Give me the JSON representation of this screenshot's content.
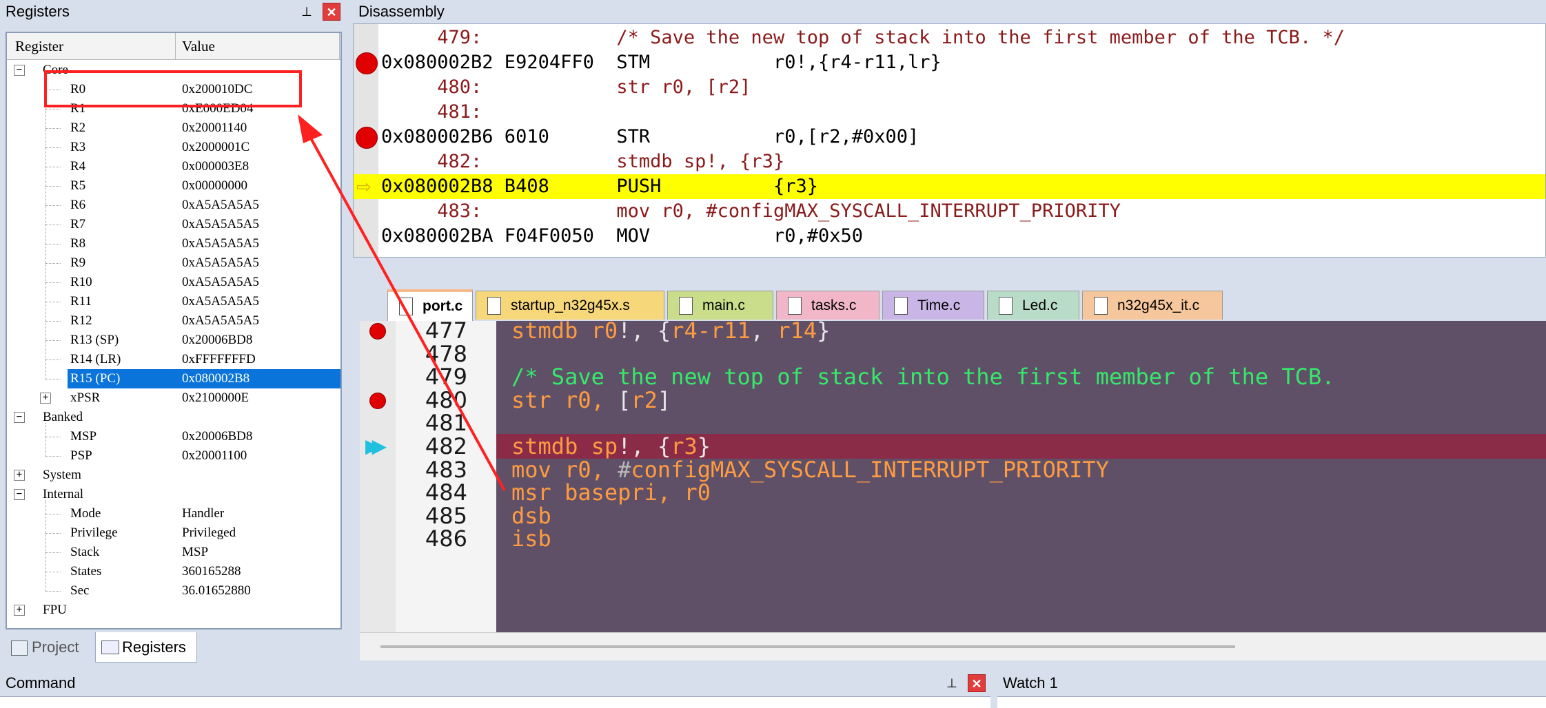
{
  "registers_pane": {
    "title": "Registers",
    "col_register": "Register",
    "col_value": "Value",
    "rows": [
      {
        "name": "Core",
        "value": "",
        "indent": 0,
        "expander": "−",
        "group": true
      },
      {
        "name": "R0",
        "value": "0x200010DC",
        "indent": 2
      },
      {
        "name": "R1",
        "value": "0xE000ED04",
        "indent": 2
      },
      {
        "name": "R2",
        "value": "0x20001140",
        "indent": 2
      },
      {
        "name": "R3",
        "value": "0x2000001C",
        "indent": 2
      },
      {
        "name": "R4",
        "value": "0x000003E8",
        "indent": 2
      },
      {
        "name": "R5",
        "value": "0x00000000",
        "indent": 2
      },
      {
        "name": "R6",
        "value": "0xA5A5A5A5",
        "indent": 2
      },
      {
        "name": "R7",
        "value": "0xA5A5A5A5",
        "indent": 2
      },
      {
        "name": "R8",
        "value": "0xA5A5A5A5",
        "indent": 2
      },
      {
        "name": "R9",
        "value": "0xA5A5A5A5",
        "indent": 2
      },
      {
        "name": "R10",
        "value": "0xA5A5A5A5",
        "indent": 2
      },
      {
        "name": "R11",
        "value": "0xA5A5A5A5",
        "indent": 2
      },
      {
        "name": "R12",
        "value": "0xA5A5A5A5",
        "indent": 2
      },
      {
        "name": "R13 (SP)",
        "value": "0x20006BD8",
        "indent": 2
      },
      {
        "name": "R14 (LR)",
        "value": "0xFFFFFFFD",
        "indent": 2
      },
      {
        "name": "R15 (PC)",
        "value": "0x080002B8",
        "indent": 2,
        "selected": true
      },
      {
        "name": "xPSR",
        "value": "0x2100000E",
        "indent": 2,
        "expander": "+"
      },
      {
        "name": "Banked",
        "value": "",
        "indent": 0,
        "expander": "−",
        "group": true
      },
      {
        "name": "MSP",
        "value": "0x20006BD8",
        "indent": 2
      },
      {
        "name": "PSP",
        "value": "0x20001100",
        "indent": 2
      },
      {
        "name": "System",
        "value": "",
        "indent": 0,
        "expander": "+",
        "group": true
      },
      {
        "name": "Internal",
        "value": "",
        "indent": 0,
        "expander": "−",
        "group": true
      },
      {
        "name": "Mode",
        "value": "Handler",
        "indent": 2
      },
      {
        "name": "Privilege",
        "value": "Privileged",
        "indent": 2
      },
      {
        "name": "Stack",
        "value": "MSP",
        "indent": 2
      },
      {
        "name": "States",
        "value": "360165288",
        "indent": 2
      },
      {
        "name": "Sec",
        "value": "36.01652880",
        "indent": 2
      },
      {
        "name": "FPU",
        "value": "",
        "indent": 0,
        "expander": "+",
        "group": true
      }
    ],
    "tabs": {
      "project": "Project",
      "registers": "Registers"
    }
  },
  "disassembly": {
    "title": "Disassembly",
    "lines": [
      {
        "kind": "src",
        "text": "     479:            /* Save the new top of stack into the first member of the TCB. */",
        "bp": false
      },
      {
        "kind": "asm",
        "text": "0x080002B2 E9204FF0  STM           r0!,{r4-r11,lr}",
        "bp": true
      },
      {
        "kind": "src",
        "text": "     480:            str r0, [r2]",
        "bp": false
      },
      {
        "kind": "src",
        "text": "     481:",
        "bp": false
      },
      {
        "kind": "asm",
        "text": "0x080002B6 6010      STR           r0,[r2,#0x00]",
        "bp": true
      },
      {
        "kind": "src",
        "text": "     482:            stmdb sp!, {r3}",
        "bp": false
      },
      {
        "kind": "asm",
        "text": "0x080002B8 B408      PUSH          {r3}",
        "bp": false,
        "current": true
      },
      {
        "kind": "src",
        "text": "     483:            mov r0, #configMAX_SYSCALL_INTERRUPT_PRIORITY",
        "bp": false
      },
      {
        "kind": "asm",
        "text": "0x080002BA F04F0050  MOV           r0,#0x50",
        "bp": false
      }
    ]
  },
  "editor": {
    "tabs": [
      {
        "label": "port.c",
        "color": "#f5b98c",
        "active": true
      },
      {
        "label": "startup_n32g45x.s",
        "color": "#f6d77a"
      },
      {
        "label": "main.c",
        "color": "#c9dd8a"
      },
      {
        "label": "tasks.c",
        "color": "#f1b7c8"
      },
      {
        "label": "Time.c",
        "color": "#c9b6e6"
      },
      {
        "label": "Led.c",
        "color": "#b9dcc9"
      },
      {
        "label": "n32g45x_it.c",
        "color": "#f6c79c"
      }
    ],
    "lines": [
      {
        "num": "477",
        "bp": true
      },
      {
        "num": "478"
      },
      {
        "num": "479"
      },
      {
        "num": "480",
        "bp": true
      },
      {
        "num": "481"
      },
      {
        "num": "482",
        "current": true
      },
      {
        "num": "483"
      },
      {
        "num": "484"
      },
      {
        "num": "485"
      },
      {
        "num": "486"
      }
    ],
    "code": {
      "l477a": "stmdb r0",
      "l477b": "!, {",
      "l477c": "r4-r11",
      "l477d": ", ",
      "l477e": "r14",
      "l477f": "}",
      "l479": "/* Save the new top of stack into the first member of the TCB.",
      "l480a": "str r0, ",
      "l480b": "[",
      "l480c": "r2",
      "l480d": "]",
      "l482a": "stmdb sp",
      "l482b": "!, {",
      "l482c": "r3",
      "l482d": "}",
      "l483a": "mov r0, ",
      "l483b": "#",
      "l483c": "configMAX_SYSCALL_INTERRUPT_PRIORITY",
      "l484": "msr basepri, r0",
      "l485": "dsb",
      "l486": "isb"
    }
  },
  "command_pane": {
    "title": "Command"
  },
  "watch_pane": {
    "title": "Watch 1"
  },
  "annotation": {
    "color": "#ff2020"
  }
}
